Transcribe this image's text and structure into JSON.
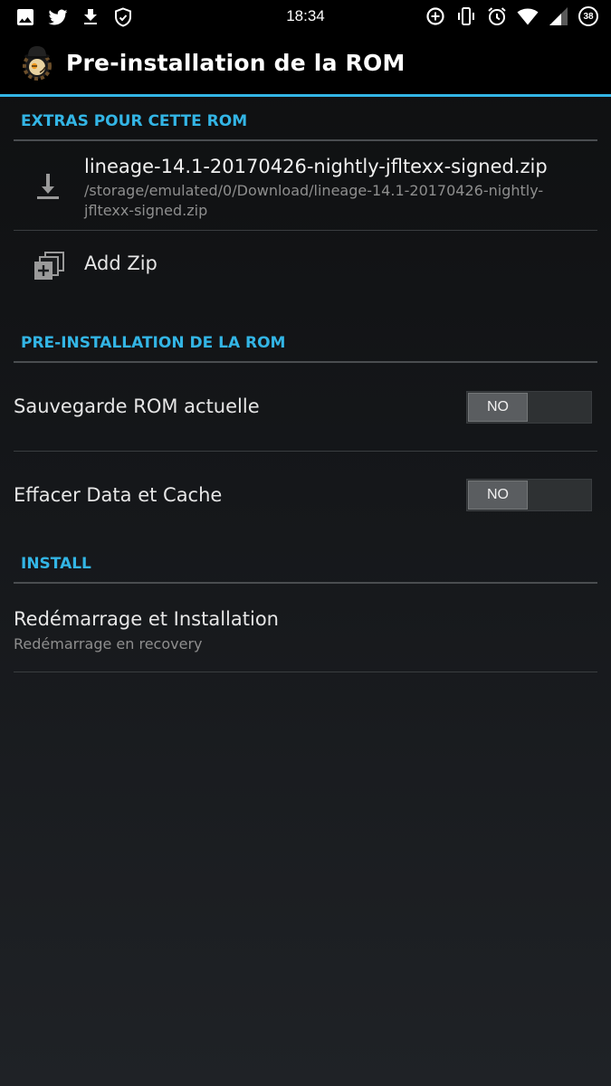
{
  "status_bar": {
    "time": "18:34",
    "battery_level": "38",
    "left_icons": [
      "image-icon",
      "twitter-icon",
      "download-icon",
      "shield-check-icon"
    ],
    "right_icons": [
      "data-saver-icon",
      "vibrate-icon",
      "alarm-icon",
      "wifi-icon",
      "signal-icon",
      "battery-icon"
    ]
  },
  "header": {
    "title": "Pre-installation de la ROM",
    "logo_icon": "rom-manager-logo",
    "accent_color": "#33b5e5"
  },
  "sections": {
    "extras": {
      "title": "EXTRAS POUR CETTE ROM",
      "zip_item": {
        "name": "lineage-14.1-20170426-nightly-jfltexx-signed.zip",
        "path": "/storage/emulated/0/Download/lineage-14.1-20170426-nightly-jfltexx-signed.zip",
        "icon": "download-icon"
      },
      "add_zip": {
        "label": "Add Zip",
        "icon": "add-zip-icon"
      }
    },
    "preinstall": {
      "title": "PRE-INSTALLATION DE LA ROM",
      "backup": {
        "label": "Sauvegarde ROM actuelle",
        "toggle": "NO"
      },
      "wipe": {
        "label": "Effacer Data et Cache",
        "toggle": "NO"
      }
    },
    "install": {
      "title": "INSTALL",
      "reboot": {
        "title": "Redémarrage et Installation",
        "subtitle": "Redémarrage en recovery"
      }
    }
  }
}
